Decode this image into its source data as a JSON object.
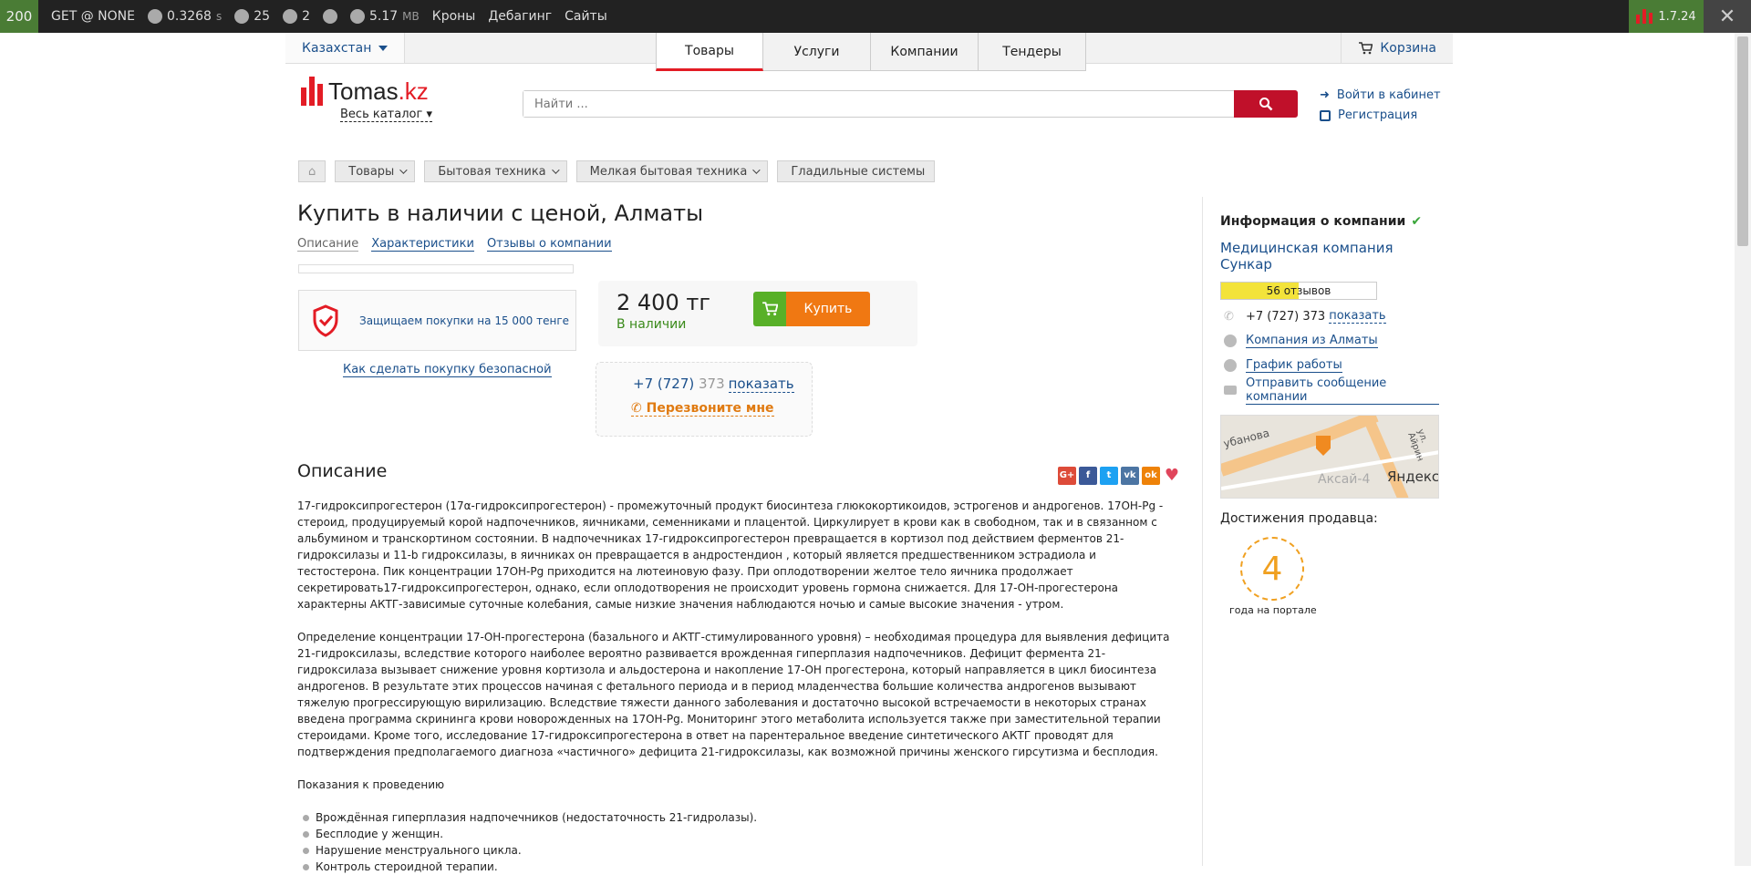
{
  "debug": {
    "status": "200",
    "request": "GET @ NONE",
    "time": "0.3268",
    "time_unit": "s",
    "queries": "25",
    "count2": "2",
    "memory": "5.17",
    "memory_unit": "MB",
    "links": [
      "Кроны",
      "Дебагинг",
      "Сайты"
    ],
    "version": "1.7.24"
  },
  "topbar": {
    "region": "Казахстан",
    "tabs": [
      "Товары",
      "Услуги",
      "Компании",
      "Тендеры"
    ],
    "cart": "Корзина"
  },
  "header": {
    "logo_main": "Tomas",
    "logo_suffix": ".kz",
    "catalog": "Весь каталог",
    "search_placeholder": "Найти ...",
    "login": "Войти в кабинет",
    "register": "Регистрация"
  },
  "breadcrumb": [
    "Товары",
    "Бытовая техника",
    "Мелкая бытовая техника",
    "Гладильные системы"
  ],
  "product": {
    "title": "Купить в наличии с ценой, Алматы",
    "subtabs": [
      "Описание",
      "Характеристики",
      "Отзывы о компании"
    ],
    "protect": "Защищаем покупки на 15 000 тенге",
    "safe_link": "Как сделать покупку безопасной",
    "price": "2 400 тг",
    "availability": "В наличии",
    "buy": "Купить",
    "phone_prefix": "+7 (727) ",
    "phone_partial": "373",
    "phone_show": "показать",
    "callback": "Перезвоните мне"
  },
  "description": {
    "heading": "Описание",
    "p1": "17-гидроксипрогестерон (17α-гидроксипрогестерон) - промежуточный продукт биосинтеза глюкокортикоидов, эстрогенов и андрогенов. 17ОН-Pg - стероид, продуцируемый корой надпочечников, яичниками, семенниками и плацентой. Циркулирует в крови как в свободном, так и в связанном с альбумином и транскортином состоянии. В надпочечниках 17-гидроксипрогестерон превращается в кортизол под действием ферментов 21-гидроксилазы и 11-b гидроксилазы, в яичниках он превращается в андростендион , который является предшественником эстрадиола и тестостерона. Пик концентрации 17ОН-Pg приходится на лютеиновую фазу. При оплодотворении желтое тело яичника продолжает секретировать17-гидроксипрогестерон, однако, если оплодотворения не происходит уровень гормона снижается. Для 17-ОН-прогестерона характерны АКТГ-зависимые суточные колебания, самые низкие значения наблюдаются ночью и самые высокие значения - утром.",
    "p2": "Определение концентрации 17-ОН-прогестерона (базального и АКТГ-стимулированного уровня) – необходимая процедура для выявления дефицита 21-гидроксилазы, вследствие которого наиболее вероятно развивается врожденная гиперплазия надпочечников. Дефицит фермента 21-гидроксилаза вызывает снижение уровня кортизола и альдостерона и накопление 17-ОН прогестерона, который направляется в цикл биосинтеза андрогенов. В результате этих процессов начиная с фетального периода и в период младенчества большие количества андрогенов вызывают тяжелую прогрессирующую вирилизацию. Вследствие тяжести данного заболевания и достаточно высокой встречаемости в некоторых странах введена программа скрининга крови новорожденных на 17ОН-Pg. Мониторинг этого метаболита используется также при заместительной терапии стероидами. Кроме того, исследование 17-гидроксипрогестерона в ответ на парентеральное введение синтетического АКТГ проводят для подтверждения предполагаемого диагноза «частичного» дефицита 21-гидроксилазы, как возможной причины женского гирсутизма и бесплодия.",
    "p3": "Показания к проведению",
    "items": [
      "Врождённая гиперплазия надпочечников (недостаточность 21-гидролазы).",
      "Бесплодие у женщин.",
      "Нарушение менструального цикла.",
      "Контроль стероидной терапии."
    ]
  },
  "company": {
    "heading": "Информация о компании",
    "name": "Медицинская компания Сункар",
    "reviews": "56 отзывов",
    "reviews_fill": 0.5,
    "phone": "+7 (727) 373",
    "phone_show": "показать",
    "city": "Компания из Алматы",
    "schedule": "График работы",
    "message": "Отправить сообщение компании",
    "map_labels": [
      "убанова",
      "Аксай-4",
      "Яндекс",
      "ул. Айрин"
    ],
    "achievements": "Достижения продавца:",
    "years": "4",
    "years_label": "года на портале"
  },
  "colors": {
    "brand_red": "#e31c25",
    "link": "#1a4f8b",
    "buy_orange": "#f07812",
    "buy_green": "#58b028"
  }
}
